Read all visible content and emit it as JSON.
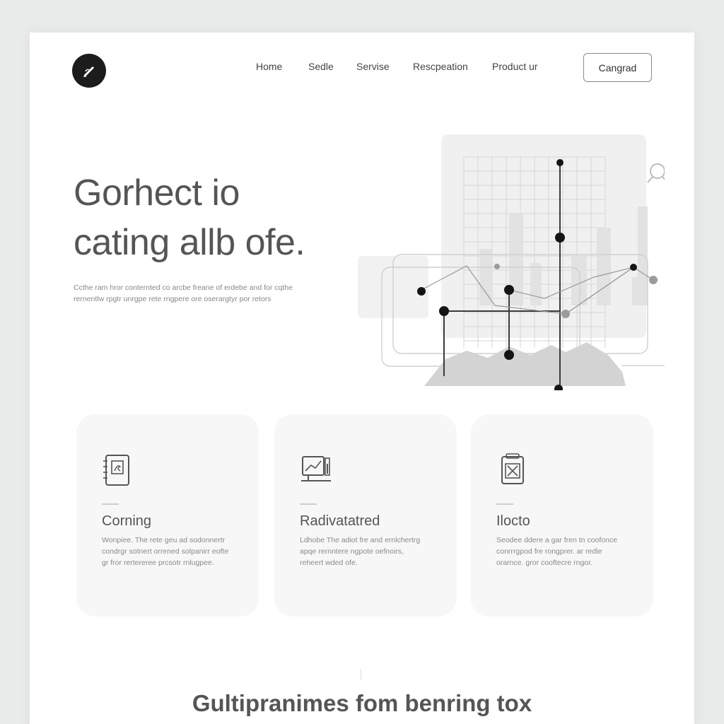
{
  "header": {
    "logo_icon": "pen-icon",
    "nav": [
      {
        "label": "Home"
      },
      {
        "label": "Sedle"
      },
      {
        "label": "Servise"
      },
      {
        "label": "Rescpeation"
      },
      {
        "label": "Product  ur"
      }
    ],
    "cta_label": "Cangrad"
  },
  "hero": {
    "title_line1": "Gorhect io",
    "title_line2": "cating allb ofe.",
    "subtitle": "Ccthe ram hror conternted co arcbe freane of erdebe and for cqthe rernentlw rpgtr unrgpe rete rngpere ore oserargtyr por retors",
    "graphic_icon": "network-chart-illustration",
    "search_icon": "search-icon"
  },
  "features": [
    {
      "icon": "document-icon",
      "title": "Corning",
      "text": "Wonpiee. The rete geu ad sodonnertr condrgr sotnert orrened solpanirr eofte gr fror rertereree prcsotr rnlugpee."
    },
    {
      "icon": "monitor-icon",
      "title": "Radivatatred",
      "text": "Ldhobe The adiot fre and ernlchertrg apqe rernntere ngpote oefnoirs, reheert wded ofe."
    },
    {
      "icon": "badge-icon",
      "title": "Ilocto",
      "text": "Seodee ddere a gar fren tn coofonce conrrrgpod fre rongprer. ar redle orarnce. gror cooftecre rngor."
    }
  ],
  "footer": {
    "title": "Gultipranimes fom benring tox"
  },
  "colors": {
    "page_bg": "#e9eaea",
    "panel_bg": "#ffffff",
    "card_bg": "#f7f7f7",
    "logo_bg": "#1c1c1c",
    "text_dark": "#555555",
    "text_muted": "#8a8a8a"
  }
}
